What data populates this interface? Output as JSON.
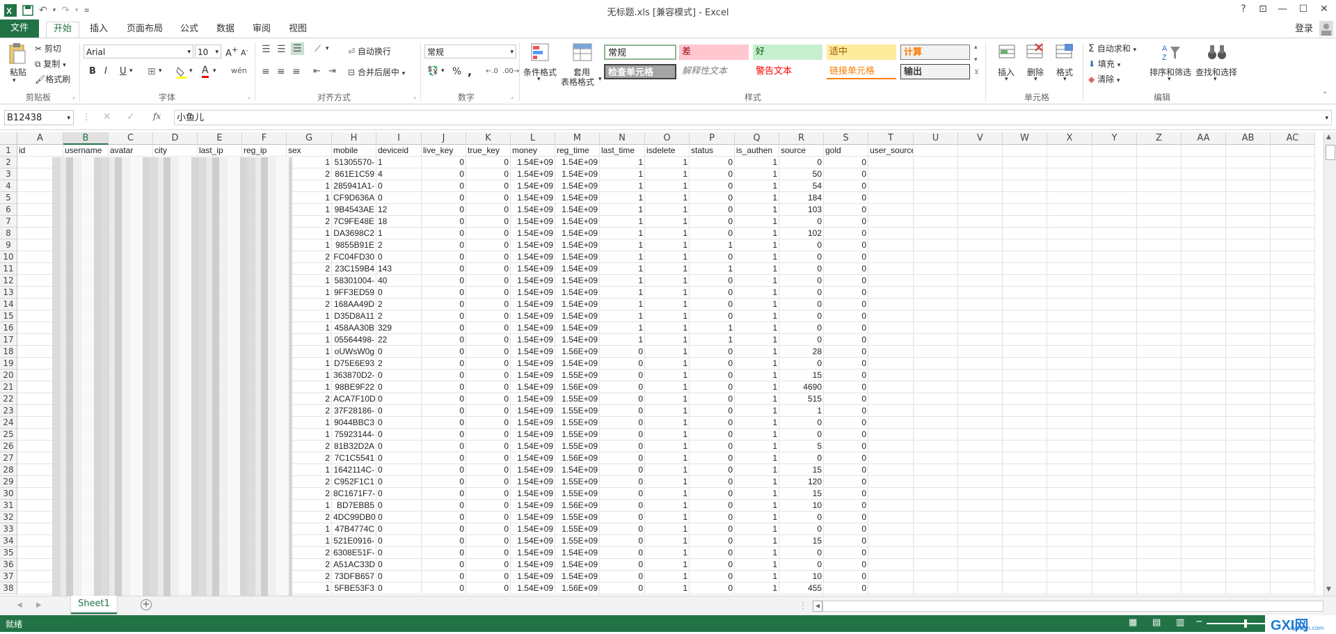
{
  "window": {
    "title": "无标题.xls  [兼容模式] - Excel",
    "help": "?",
    "login": "登录"
  },
  "tabs": [
    "文件",
    "开始",
    "插入",
    "页面布局",
    "公式",
    "数据",
    "审阅",
    "视图"
  ],
  "active_tab_index": 1,
  "ribbon": {
    "clipboard": {
      "paste": "粘贴",
      "cut": "剪切",
      "copy": "复制",
      "format_painter": "格式刷",
      "group": "剪贴板"
    },
    "font": {
      "family": "Arial",
      "size": "10",
      "bold": "B",
      "italic": "I",
      "underline": "U",
      "font_color_letter": "A",
      "group": "字体"
    },
    "alignment": {
      "wrap": "自动换行",
      "merge": "合并后居中",
      "group": "对齐方式"
    },
    "number": {
      "format": "常规",
      "percent": "%",
      "comma": ",",
      "group": "数字"
    },
    "styles": {
      "cond_format": "条件格式",
      "table_format_1": "套用",
      "table_format_2": "表格格式",
      "items": [
        "常规",
        "差",
        "好",
        "适中",
        "计算",
        "检查单元格",
        "解释性文本",
        "警告文本",
        "链接单元格",
        "输出"
      ],
      "group": "样式"
    },
    "cells": {
      "insert": "插入",
      "delete": "删除",
      "format": "格式",
      "group": "单元格"
    },
    "editing": {
      "autosum": "自动求和",
      "fill": "填充",
      "clear": "清除",
      "sort_filter": "排序和筛选",
      "find_select": "查找和选择",
      "group": "编辑"
    }
  },
  "formula_bar": {
    "name_box": "B12438",
    "fx": "fx",
    "content": "小鱼儿"
  },
  "grid": {
    "columns": [
      "A",
      "B",
      "C",
      "D",
      "E",
      "F",
      "G",
      "H",
      "I",
      "J",
      "K",
      "L",
      "M",
      "N",
      "O",
      "P",
      "Q",
      "R",
      "S",
      "T",
      "U",
      "V",
      "W",
      "X",
      "Y",
      "Z",
      "AA",
      "AB",
      "AC"
    ],
    "selected_column": "B",
    "headers": [
      "id",
      "username",
      "avatar",
      "city",
      "last_ip",
      "reg_ip",
      "sex",
      "mobile",
      "deviceid",
      "live_key",
      "true_key",
      "money",
      "reg_time",
      "last_time",
      "isdelete",
      "status",
      "is_authen",
      "source",
      "gold",
      "user_source"
    ],
    "rows": [
      [
        2,
        "1",
        "51305570-",
        "1",
        "0",
        "0",
        "1.54E+09",
        "1.54E+09",
        "1",
        "1",
        "0",
        "1",
        "0",
        "0"
      ],
      [
        3,
        "2",
        "861E1C59",
        "4",
        "0",
        "0",
        "1.54E+09",
        "1.54E+09",
        "1",
        "1",
        "0",
        "1",
        "50",
        "0"
      ],
      [
        4,
        "1",
        "285941A1-",
        "0",
        "0",
        "0",
        "1.54E+09",
        "1.54E+09",
        "1",
        "1",
        "0",
        "1",
        "54",
        "0"
      ],
      [
        5,
        "1",
        "CF9D636A",
        "0",
        "0",
        "0",
        "1.54E+09",
        "1.54E+09",
        "1",
        "1",
        "0",
        "1",
        "184",
        "0"
      ],
      [
        6,
        "1",
        "9B4543AE",
        "12",
        "0",
        "0",
        "1.54E+09",
        "1.54E+09",
        "1",
        "1",
        "0",
        "1",
        "103",
        "0"
      ],
      [
        7,
        "2",
        "7C9FE48E",
        "18",
        "0",
        "0",
        "1.54E+09",
        "1.54E+09",
        "1",
        "1",
        "0",
        "1",
        "0",
        "0"
      ],
      [
        8,
        "1",
        "DA3698C2",
        "1",
        "0",
        "0",
        "1.54E+09",
        "1.54E+09",
        "1",
        "1",
        "0",
        "1",
        "102",
        "0"
      ],
      [
        9,
        "1",
        "9855B91E",
        "2",
        "0",
        "0",
        "1.54E+09",
        "1.54E+09",
        "1",
        "1",
        "1",
        "1",
        "0",
        "0"
      ],
      [
        10,
        "2",
        "FC04FD30",
        "0",
        "0",
        "0",
        "1.54E+09",
        "1.54E+09",
        "1",
        "1",
        "0",
        "1",
        "0",
        "0"
      ],
      [
        11,
        "2",
        "23C159B4",
        "143",
        "0",
        "0",
        "1.54E+09",
        "1.54E+09",
        "1",
        "1",
        "1",
        "1",
        "0",
        "0"
      ],
      [
        12,
        "1",
        "58301004-",
        "40",
        "0",
        "0",
        "1.54E+09",
        "1.54E+09",
        "1",
        "1",
        "0",
        "1",
        "0",
        "0"
      ],
      [
        13,
        "1",
        "9FF3ED59",
        "0",
        "0",
        "0",
        "1.54E+09",
        "1.54E+09",
        "1",
        "1",
        "0",
        "1",
        "0",
        "0"
      ],
      [
        14,
        "2",
        "168AA49D",
        "2",
        "0",
        "0",
        "1.54E+09",
        "1.54E+09",
        "1",
        "1",
        "0",
        "1",
        "0",
        "0"
      ],
      [
        15,
        "1",
        "D35D8A11",
        "2",
        "0",
        "0",
        "1.54E+09",
        "1.54E+09",
        "1",
        "1",
        "0",
        "1",
        "0",
        "0"
      ],
      [
        16,
        "1",
        "458AA30B",
        "329",
        "0",
        "0",
        "1.54E+09",
        "1.54E+09",
        "1",
        "1",
        "1",
        "1",
        "0",
        "0"
      ],
      [
        17,
        "1",
        "05564498-",
        "22",
        "0",
        "0",
        "1.54E+09",
        "1.54E+09",
        "1",
        "1",
        "1",
        "1",
        "0",
        "0"
      ],
      [
        18,
        "1",
        "oUWsW0g",
        "0",
        "0",
        "0",
        "1.54E+09",
        "1.56E+09",
        "0",
        "1",
        "0",
        "1",
        "28",
        "0"
      ],
      [
        19,
        "1",
        "D75E6E93",
        "2",
        "0",
        "0",
        "1.54E+09",
        "1.54E+09",
        "0",
        "1",
        "0",
        "1",
        "0",
        "0"
      ],
      [
        20,
        "1",
        "363870D2-",
        "0",
        "0",
        "0",
        "1.54E+09",
        "1.55E+09",
        "0",
        "1",
        "0",
        "1",
        "15",
        "0"
      ],
      [
        21,
        "1",
        "98BE9F22",
        "0",
        "0",
        "0",
        "1.54E+09",
        "1.56E+09",
        "0",
        "1",
        "0",
        "1",
        "4690",
        "0"
      ],
      [
        22,
        "2",
        "ACA7F10D",
        "0",
        "0",
        "0",
        "1.54E+09",
        "1.55E+09",
        "0",
        "1",
        "0",
        "1",
        "515",
        "0"
      ],
      [
        23,
        "2",
        "37F28186-",
        "0",
        "0",
        "0",
        "1.54E+09",
        "1.55E+09",
        "0",
        "1",
        "0",
        "1",
        "1",
        "0"
      ],
      [
        24,
        "1",
        "9044BBC3",
        "0",
        "0",
        "0",
        "1.54E+09",
        "1.55E+09",
        "0",
        "1",
        "0",
        "1",
        "0",
        "0"
      ],
      [
        25,
        "1",
        "75923144-",
        "0",
        "0",
        "0",
        "1.54E+09",
        "1.55E+09",
        "0",
        "1",
        "0",
        "1",
        "0",
        "0"
      ],
      [
        26,
        "2",
        "81B32D2A",
        "0",
        "0",
        "0",
        "1.54E+09",
        "1.55E+09",
        "0",
        "1",
        "0",
        "1",
        "5",
        "0"
      ],
      [
        27,
        "2",
        "7C1C5541",
        "0",
        "0",
        "0",
        "1.54E+09",
        "1.56E+09",
        "0",
        "1",
        "0",
        "1",
        "0",
        "0"
      ],
      [
        28,
        "1",
        "1642114C-",
        "0",
        "0",
        "0",
        "1.54E+09",
        "1.54E+09",
        "0",
        "1",
        "0",
        "1",
        "15",
        "0"
      ],
      [
        29,
        "2",
        "C952F1C1",
        "0",
        "0",
        "0",
        "1.54E+09",
        "1.55E+09",
        "0",
        "1",
        "0",
        "1",
        "120",
        "0"
      ],
      [
        30,
        "2",
        "8C1671F7-",
        "0",
        "0",
        "0",
        "1.54E+09",
        "1.55E+09",
        "0",
        "1",
        "0",
        "1",
        "15",
        "0"
      ],
      [
        31,
        "1",
        "BD7EBB5",
        "0",
        "0",
        "0",
        "1.54E+09",
        "1.56E+09",
        "0",
        "1",
        "0",
        "1",
        "10",
        "0"
      ],
      [
        32,
        "2",
        "4DC99DB0",
        "0",
        "0",
        "0",
        "1.54E+09",
        "1.55E+09",
        "0",
        "1",
        "0",
        "1",
        "0",
        "0"
      ],
      [
        33,
        "1",
        "47B4774C",
        "0",
        "0",
        "0",
        "1.54E+09",
        "1.55E+09",
        "0",
        "1",
        "0",
        "1",
        "0",
        "0"
      ],
      [
        34,
        "1",
        "521E0916-",
        "0",
        "0",
        "0",
        "1.54E+09",
        "1.55E+09",
        "0",
        "1",
        "0",
        "1",
        "15",
        "0"
      ],
      [
        35,
        "2",
        "6308E51F-",
        "0",
        "0",
        "0",
        "1.54E+09",
        "1.54E+09",
        "0",
        "1",
        "0",
        "1",
        "0",
        "0"
      ],
      [
        36,
        "2",
        "A51AC33D",
        "0",
        "0",
        "0",
        "1.54E+09",
        "1.54E+09",
        "0",
        "1",
        "0",
        "1",
        "0",
        "0"
      ],
      [
        37,
        "2",
        "73DFB657",
        "0",
        "0",
        "0",
        "1.54E+09",
        "1.54E+09",
        "0",
        "1",
        "0",
        "1",
        "10",
        "0"
      ],
      [
        38,
        "1",
        "5FBE53F3",
        "0",
        "0",
        "0",
        "1.54E+09",
        "1.56E+09",
        "0",
        "1",
        "0",
        "1",
        "455",
        "0"
      ]
    ]
  },
  "sheet_tabs": [
    "Sheet1"
  ],
  "status": {
    "ready": "就绪"
  },
  "watermark": {
    "brand": "GXI网",
    "site": "system.com"
  }
}
